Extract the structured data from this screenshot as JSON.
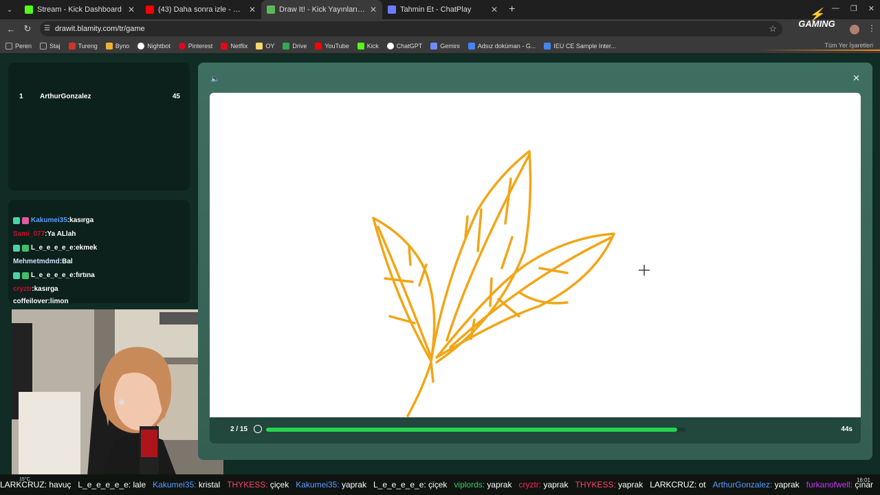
{
  "browser": {
    "tabs": [
      {
        "title": "Stream - Kick Dashboard",
        "color": "#53fc18"
      },
      {
        "title": "(43) Daha sonra izle - YouTube",
        "color": "#ff0000"
      },
      {
        "title": "Draw It! - Kick Yayınları İçin Çiz",
        "color": "#5cb85c"
      },
      {
        "title": "Tahmin Et - ChatPlay",
        "color": "#6c7bff"
      }
    ],
    "url": "drawit.blamity.com/tr/game",
    "bookmarks": [
      {
        "label": "Peren",
        "color": "#aaaaaa"
      },
      {
        "label": "Staj",
        "color": "#aaaaaa"
      },
      {
        "label": "Tureng",
        "color": "#d0342c"
      },
      {
        "label": "Byno",
        "color": "#f0b030"
      },
      {
        "label": "Nightbot",
        "color": "#ffffff"
      },
      {
        "label": "Pinterest",
        "color": "#e60023"
      },
      {
        "label": "Netflix",
        "color": "#e50914"
      },
      {
        "label": "OY",
        "color": "#f5d76e"
      },
      {
        "label": "Drive",
        "color": "#34a853"
      },
      {
        "label": "YouTube",
        "color": "#ff0000"
      },
      {
        "label": "Kick",
        "color": "#53fc18"
      },
      {
        "label": "ChatGPT",
        "color": "#ffffff"
      },
      {
        "label": "Gemini",
        "color": "#6b8cff"
      },
      {
        "label": "Adsız doküman - G...",
        "color": "#4285f4"
      },
      {
        "label": "IEU CE Sample Inter...",
        "color": "#4285f4"
      }
    ],
    "all_bookmarks": "Tüm Yer İşaretleri",
    "logo_text": "GAMING"
  },
  "leaderboard": {
    "rows": [
      {
        "rank": "1",
        "name": "ArthurGonzalez",
        "score": "45"
      }
    ]
  },
  "chat": [
    {
      "user": "Kakumei35",
      "msg": "kasırga",
      "color": "#5a9cff"
    },
    {
      "user": "Sami_077",
      "msg": "Ya ALlah",
      "color": "#c8102e"
    },
    {
      "user": "L_e_e_e_e_e",
      "msg": "ekmek",
      "color": "#e8f0ec"
    },
    {
      "user": "Mehmetmdmd",
      "msg": "Bal",
      "color": "#cfe2ff"
    },
    {
      "user": "L_e_e_e_e_e",
      "msg": "fırtına",
      "color": "#e8f0ec"
    },
    {
      "user": "cryztr",
      "msg": "kasırga",
      "color": "#c8102e"
    },
    {
      "user": "coffeilover",
      "msg": "limon",
      "color": "#e8f0ec"
    }
  ],
  "game": {
    "round": "2 / 15",
    "time_left": "44s",
    "progress": 0.98,
    "stroke_color": "#f2a516"
  },
  "ticker": [
    {
      "user": "LARKCRUZ:",
      "msg": "havuç",
      "color": "#ffffff"
    },
    {
      "user": "L_e_e_e_e_e:",
      "msg": "lale",
      "color": "#ffffff"
    },
    {
      "user": "Kakumei35:",
      "msg": "kristal",
      "color": "#5a9cff"
    },
    {
      "user": "THYKESS:",
      "msg": "çiçek",
      "color": "#ff4466"
    },
    {
      "user": "Kakumei35:",
      "msg": "yaprak",
      "color": "#5a9cff"
    },
    {
      "user": "L_e_e_e_e_e:",
      "msg": "çiçek",
      "color": "#ffffff"
    },
    {
      "user": "viplords:",
      "msg": "yaprak",
      "color": "#33cc66"
    },
    {
      "user": "cryztr:",
      "msg": "yaprak",
      "color": "#ff2255"
    },
    {
      "user": "THYKESS:",
      "msg": "yaprak",
      "color": "#ff4466"
    },
    {
      "user": "LARKCRUZ:",
      "msg": "ot",
      "color": "#ffffff"
    },
    {
      "user": "ArthurGonzalez:",
      "msg": "yaprak",
      "color": "#5a9cff"
    },
    {
      "user": "furkanofwell:",
      "msg": "çınar",
      "color": "#cc33ff"
    }
  ],
  "taskbar": {
    "time": "16:01",
    "weather": "15°C"
  }
}
